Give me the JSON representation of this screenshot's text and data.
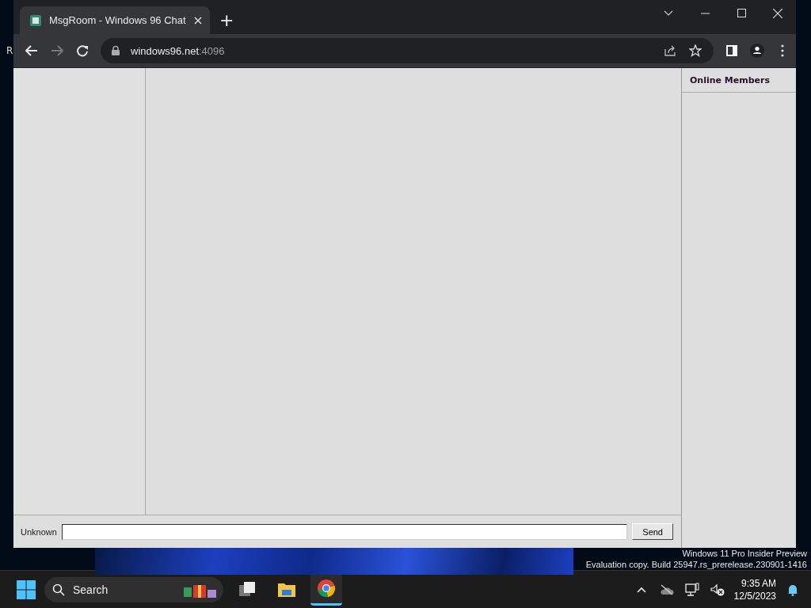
{
  "desktop": {
    "icon_label": "R",
    "watermark": [
      "Windows 11 Pro Insider Preview",
      "Evaluation copy. Build 25947.rs_prerelease.230901-1416"
    ]
  },
  "browser": {
    "tabs": [
      {
        "title": "MsgRoom - Windows 96 Chat",
        "selected": true
      }
    ],
    "new_tab": "+",
    "url_host": "windows96.net",
    "url_port": ":4096"
  },
  "page": {
    "members_title": "Online Members",
    "name_label": "Unknown",
    "send_button": "Send"
  },
  "taskbar": {
    "search_placeholder": "Search",
    "apps": [
      {
        "kind": "taskview",
        "selected": false
      },
      {
        "kind": "files",
        "selected": false
      },
      {
        "kind": "chrome",
        "selected": true
      }
    ],
    "time": "9:35 AM",
    "date": "12/5/2023"
  }
}
